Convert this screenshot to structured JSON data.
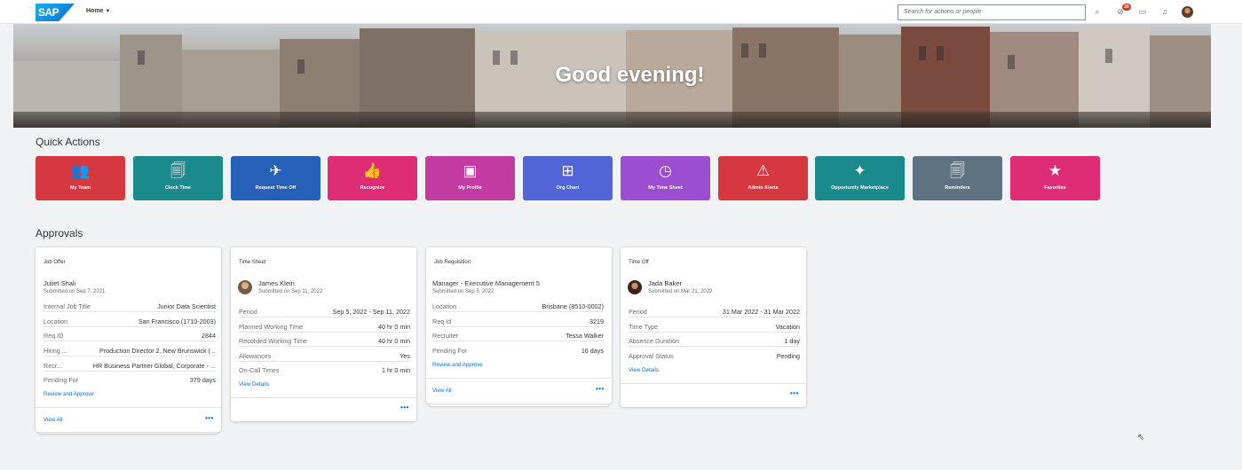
{
  "header": {
    "logo_text": "SAP",
    "home_label": "Home",
    "search_placeholder": "Search for actions or people",
    "notifications_count": "39",
    "icons": [
      "search-icon",
      "approvals-icon",
      "chat-icon",
      "bell-icon",
      "avatar"
    ]
  },
  "banner": {
    "greeting": "Good evening!"
  },
  "quick_actions": {
    "title": "Quick Actions",
    "tiles": [
      {
        "label": "My Team",
        "color": "#d6383f",
        "icon": "👥"
      },
      {
        "label": "Clock Time",
        "color": "#1b8a8d",
        "icon": "🗐"
      },
      {
        "label": "Request Time Off",
        "color": "#2760b8",
        "icon": "✈"
      },
      {
        "label": "Recognize",
        "color": "#de2d74",
        "icon": "👍"
      },
      {
        "label": "My Profile",
        "color": "#c23ba3",
        "icon": "▣"
      },
      {
        "label": "Org Chart",
        "color": "#5364d6",
        "icon": "⊞"
      },
      {
        "label": "My Time Sheet",
        "color": "#9b4fd0",
        "icon": "◷"
      },
      {
        "label": "Admin Alerts",
        "color": "#d6383f",
        "icon": "⚠"
      },
      {
        "label": "Opportunity Marketplace",
        "color": "#1b8a8d",
        "icon": "✦"
      },
      {
        "label": "Reminders",
        "color": "#5f7282",
        "icon": "🗐"
      },
      {
        "label": "Favorites",
        "color": "#de2d74",
        "icon": "★"
      }
    ]
  },
  "approvals": {
    "title": "Approvals",
    "cards": [
      {
        "type": "Job Offer",
        "name": "Juliet Shali",
        "submitted": "Submitted on Sep 7, 2021",
        "rows": [
          {
            "k": "Internal Job Title",
            "v": "Junior Data Scientist"
          },
          {
            "k": "Location",
            "v": "San Francisco (1710-2003)"
          },
          {
            "k": "Req ID",
            "v": "2844"
          },
          {
            "k": "Hiring ...",
            "v": "Production Director 2, New Brunswick (..."
          },
          {
            "k": "Recr...",
            "v": "HR Business Partner Global, Corporate - ..."
          },
          {
            "k": "Pending For",
            "v": "379 days"
          }
        ],
        "action": "Review and Approve",
        "footer": "View All"
      },
      {
        "type": "Time Sheet",
        "name": "James Klein",
        "submitted": "Submitted on Sep 11, 2022",
        "rows": [
          {
            "k": "Period",
            "v": "Sep 5, 2022 - Sep 11, 2022"
          },
          {
            "k": "Planned Working Time",
            "v": "40 hr 0 min"
          },
          {
            "k": "Recorded Working Time",
            "v": "40 hr 0 min"
          },
          {
            "k": "Allowances",
            "v": "Yes"
          },
          {
            "k": "On-Call Times",
            "v": "1 hr 0 min"
          }
        ],
        "action": "View Details",
        "footer": ""
      },
      {
        "type": "Job Requisition",
        "name": "Manager - Executive Management 5",
        "submitted": "Submitted on Sep 5, 2022",
        "rows": [
          {
            "k": "Location",
            "v": "Brisbane (8510-0002)"
          },
          {
            "k": "Req Id",
            "v": "3219"
          },
          {
            "k": "Recruiter",
            "v": "Tessa Walker"
          },
          {
            "k": "Pending For",
            "v": "16 days"
          }
        ],
        "action": "Review and Approve",
        "footer": "View All"
      },
      {
        "type": "Time Off",
        "name": "Jada Baker",
        "submitted": "Submitted on Mar 21, 2022",
        "rows": [
          {
            "k": "Period",
            "v": "31 Mar 2022 - 31 Mar 2022"
          },
          {
            "k": "Time Type",
            "v": "Vacation"
          },
          {
            "k": "Absence Duration",
            "v": "1 day"
          },
          {
            "k": "Approval Status",
            "v": "Pending"
          }
        ],
        "action": "View Details",
        "footer": ""
      }
    ]
  },
  "more_label": "•••"
}
